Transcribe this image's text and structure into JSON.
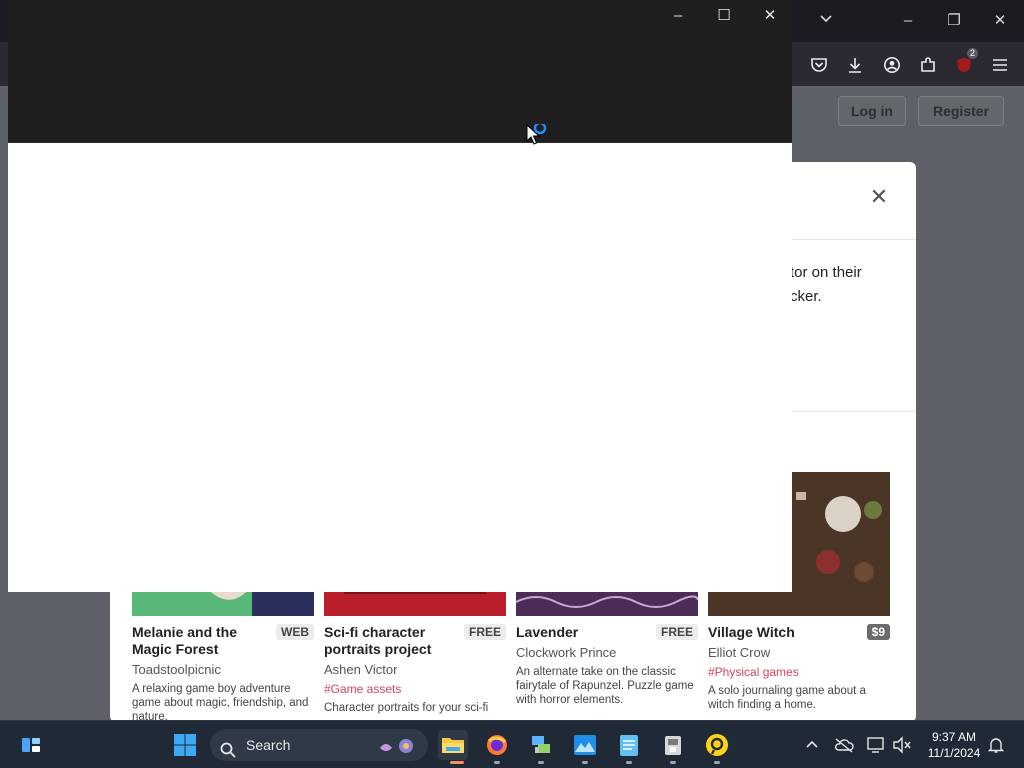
{
  "browser": {
    "tab_list_icon": "chevron-down-icon",
    "window_controls": {
      "minimize": "–",
      "restore": "❐",
      "close": "✕"
    },
    "toolbar_badge": "2"
  },
  "site": {
    "login_label": "Log in",
    "register_label": "Register"
  },
  "modal": {
    "close_glyph": "✕",
    "text_fragment_1": "tor on their",
    "text_fragment_2": "cker.",
    "cards": [
      {
        "title": "Melanie and the Magic Forest",
        "badge": "WEB",
        "author": "Toadstoolpicnic",
        "tag": "",
        "description": "A relaxing game boy adventure game about magic, friendship, and nature.",
        "thumb_color": "#58b87a"
      },
      {
        "title": "Sci-fi character portraits project",
        "badge": "FREE",
        "author": "Ashen Victor",
        "tag": "#Game assets",
        "description": "Character portraits for your sci-fi",
        "thumb_color": "#b81f2a"
      },
      {
        "title": "Lavender",
        "badge": "FREE",
        "author": "Clockwork Prince",
        "tag": "",
        "description": "An alternate take on the classic fairytale of Rapunzel. Puzzle game with horror elements.",
        "thumb_color": "#4b2d57"
      },
      {
        "title": "Village Witch",
        "badge": "$9",
        "author": "Elliot Crow",
        "tag": "#Physical games",
        "description": "A solo journaling game about a witch finding a home.",
        "thumb_color": "#4a3527"
      }
    ]
  },
  "app_window": {
    "minimize": "–",
    "maximize": "☐",
    "close": "✕"
  },
  "taskbar": {
    "search_label": "Search",
    "time": "9:37 AM",
    "date": "11/1/2024",
    "accent": "#0078d4"
  }
}
